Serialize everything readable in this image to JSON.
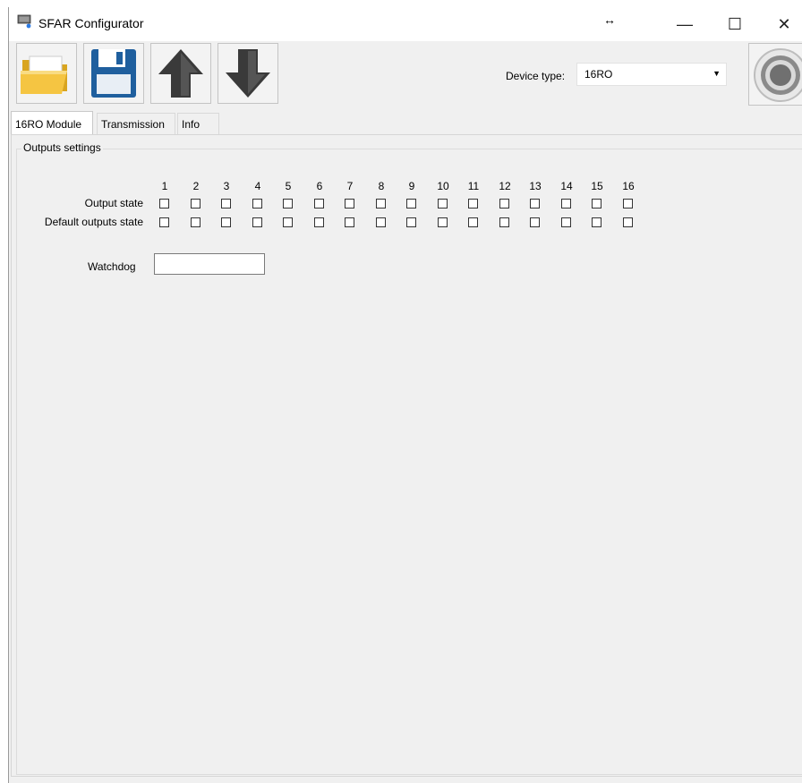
{
  "window": {
    "title": "SFAR Configurator",
    "controls": {
      "resize_glyph": "↔",
      "minimize": "—",
      "maximize": "☐",
      "close": "✕"
    }
  },
  "toolbar": {
    "buttons": [
      {
        "icon": "folder-open-icon",
        "action": "open"
      },
      {
        "icon": "floppy-disk-icon",
        "action": "save"
      },
      {
        "icon": "arrow-up-icon",
        "action": "upload"
      },
      {
        "icon": "arrow-down-icon",
        "action": "download"
      }
    ],
    "device_type_label": "Device type:",
    "device_type_value": "16RO",
    "connect_icon": "connect-icon"
  },
  "tabs": [
    {
      "label": "16RO Module",
      "active": true
    },
    {
      "label": "Transmission",
      "active": false
    },
    {
      "label": "Info",
      "active": false
    }
  ],
  "outputs": {
    "group_title": "Outputs settings",
    "columns": [
      "1",
      "2",
      "3",
      "4",
      "5",
      "6",
      "7",
      "8",
      "9",
      "10",
      "11",
      "12",
      "13",
      "14",
      "15",
      "16"
    ],
    "rows": [
      {
        "label": "Output state",
        "checked": [
          false,
          false,
          false,
          false,
          false,
          false,
          false,
          false,
          false,
          false,
          false,
          false,
          false,
          false,
          false,
          false
        ]
      },
      {
        "label": "Default outputs state",
        "checked": [
          false,
          false,
          false,
          false,
          false,
          false,
          false,
          false,
          false,
          false,
          false,
          false,
          false,
          false,
          false,
          false
        ]
      }
    ],
    "watchdog_label": "Watchdog",
    "watchdog_value": ""
  },
  "colors": {
    "window_bg": "#f0f0f0",
    "titlebar_bg": "#ffffff",
    "folder": "#f5c542",
    "floppy": "#1f5f9e",
    "arrow": "#3a3a3a"
  }
}
